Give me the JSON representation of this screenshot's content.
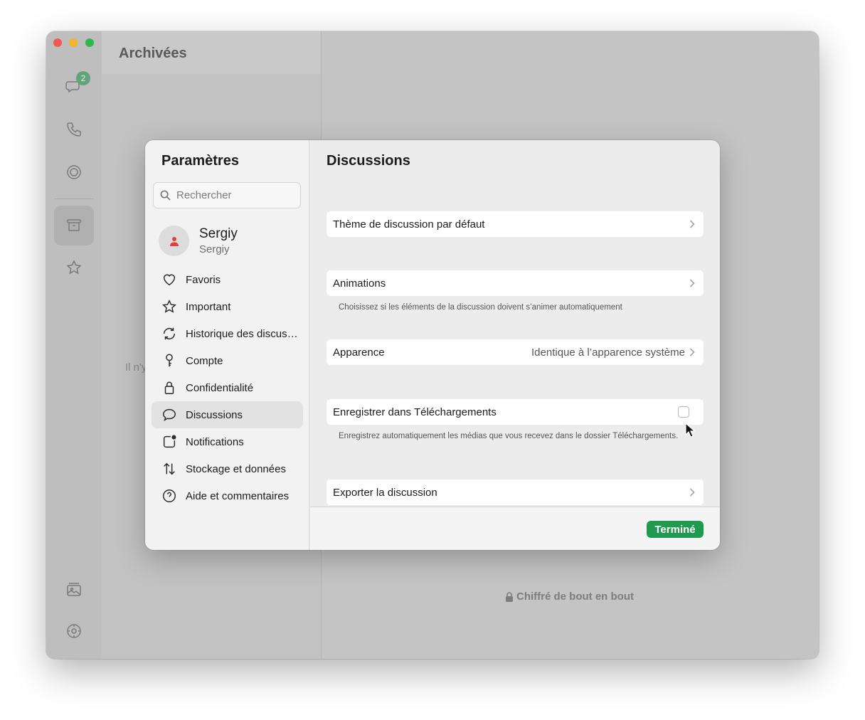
{
  "app": {
    "list_title": "Archivées",
    "unread_badge": "2",
    "empty_text_partial": "Il n'y",
    "encrypted_label": "Chiffré de bout en bout"
  },
  "settings": {
    "title": "Paramètres",
    "search_placeholder": "Rechercher",
    "profile": {
      "name": "Sergiy",
      "subtitle": "Sergiy"
    },
    "nav": [
      {
        "label": "Favoris",
        "icon": "heart-icon"
      },
      {
        "label": "Important",
        "icon": "star-icon"
      },
      {
        "label": "Historique des discussions",
        "icon": "sync-icon"
      },
      {
        "label": "Compte",
        "icon": "key-icon"
      },
      {
        "label": "Confidentialité",
        "icon": "lock-icon"
      },
      {
        "label": "Discussions",
        "icon": "chat-bubble-icon",
        "active": true
      },
      {
        "label": "Notifications",
        "icon": "notification-icon"
      },
      {
        "label": "Stockage et données",
        "icon": "arrows-updown-icon"
      },
      {
        "label": "Aide et commentaires",
        "icon": "help-icon"
      }
    ]
  },
  "discussions": {
    "title": "Discussions",
    "theme_label": "Thème de discussion par défaut",
    "animations_label": "Animations",
    "animations_note": "Choisissez si les éléments de la discussion doivent s’animer automatiquement",
    "appearance_label": "Apparence",
    "appearance_value": "Identique à l’apparence système",
    "save_downloads_label": "Enregistrer dans Téléchargements",
    "save_downloads_checked": false,
    "save_downloads_note": "Enregistrez automatiquement les médias que vous recevez dans le dossier Téléchargements.",
    "export_label": "Exporter la discussion",
    "done_label": "Terminé"
  },
  "colors": {
    "accent_green": "#1f9a4f",
    "avatar_icon_red": "#e0403b"
  }
}
